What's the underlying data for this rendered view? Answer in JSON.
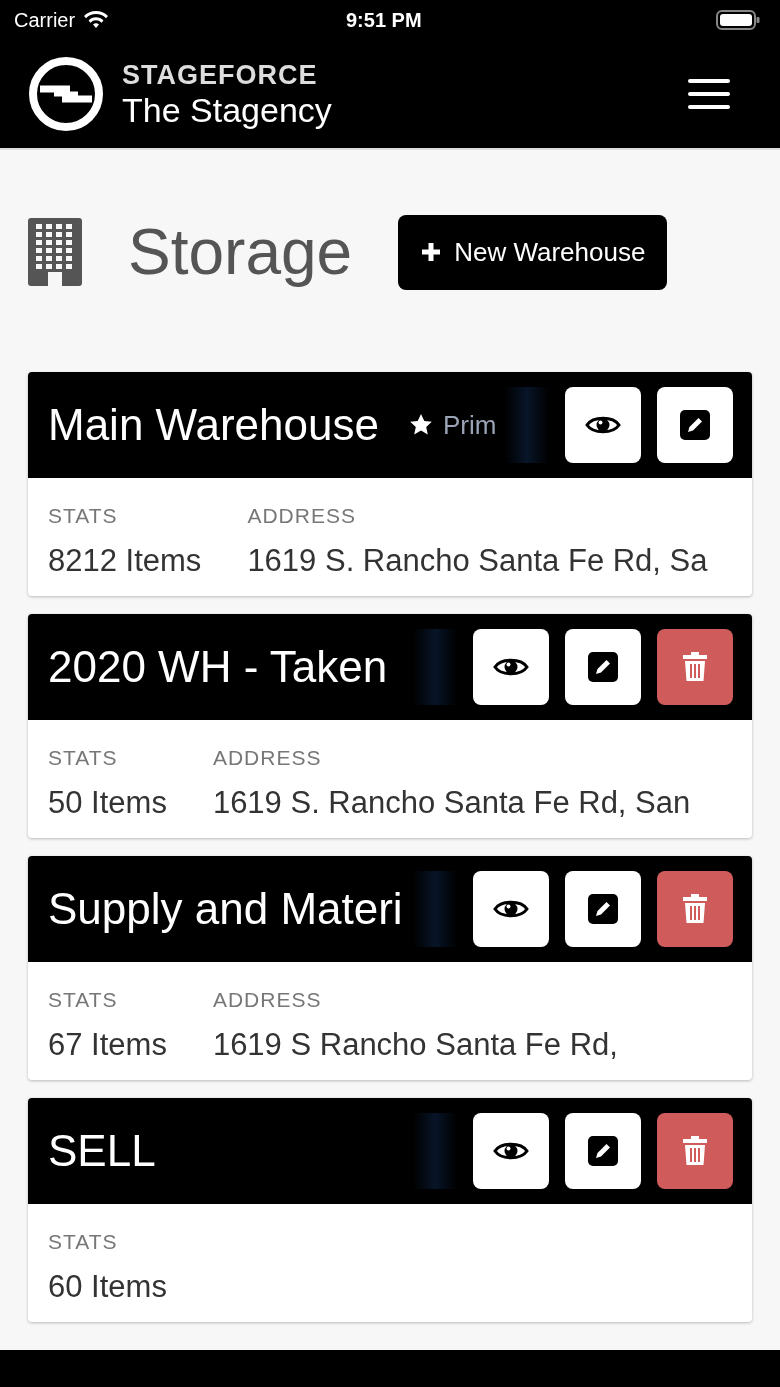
{
  "status_bar": {
    "carrier": "Carrier",
    "time": "9:51 PM"
  },
  "header": {
    "brand": "STAGEFORCE",
    "company": "The Stagency"
  },
  "page": {
    "title": "Storage",
    "new_button": "New Warehouse"
  },
  "warehouses": [
    {
      "name": "Main Warehouse",
      "primary": true,
      "primary_label": "Prim",
      "actions": [
        {
          "kind": "view"
        },
        {
          "kind": "edit"
        }
      ],
      "stats_label": "STATS",
      "items": "8212 Items",
      "address_label": "ADDRESS",
      "address": "1619 S. Rancho Santa Fe Rd, Sa"
    },
    {
      "name": "2020 WH - Taken",
      "primary": false,
      "actions": [
        {
          "kind": "view"
        },
        {
          "kind": "edit"
        },
        {
          "kind": "delete"
        }
      ],
      "stats_label": "STATS",
      "items": "50 Items",
      "address_label": "ADDRESS",
      "address": "1619 S. Rancho Santa Fe Rd, San"
    },
    {
      "name": "Supply and Materi",
      "primary": false,
      "actions": [
        {
          "kind": "view"
        },
        {
          "kind": "edit"
        },
        {
          "kind": "delete"
        }
      ],
      "stats_label": "STATS",
      "items": "67 Items",
      "address_label": "ADDRESS",
      "address": "1619 S Rancho Santa Fe Rd,"
    },
    {
      "name": "SELL",
      "primary": false,
      "actions": [
        {
          "kind": "view"
        },
        {
          "kind": "edit"
        },
        {
          "kind": "delete"
        }
      ],
      "stats_label": "STATS",
      "items": "60 Items"
    }
  ]
}
